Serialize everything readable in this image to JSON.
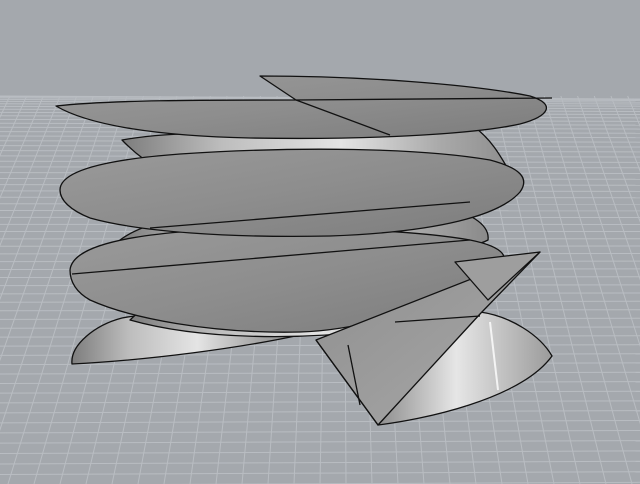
{
  "viewport": {
    "label": "",
    "background_color": "#a4a8ad",
    "grid_color": "#b9bdc2",
    "surface_color": "#b4b4b4",
    "edge_color": "#111111",
    "object": "twisted-helical-surface-model"
  }
}
